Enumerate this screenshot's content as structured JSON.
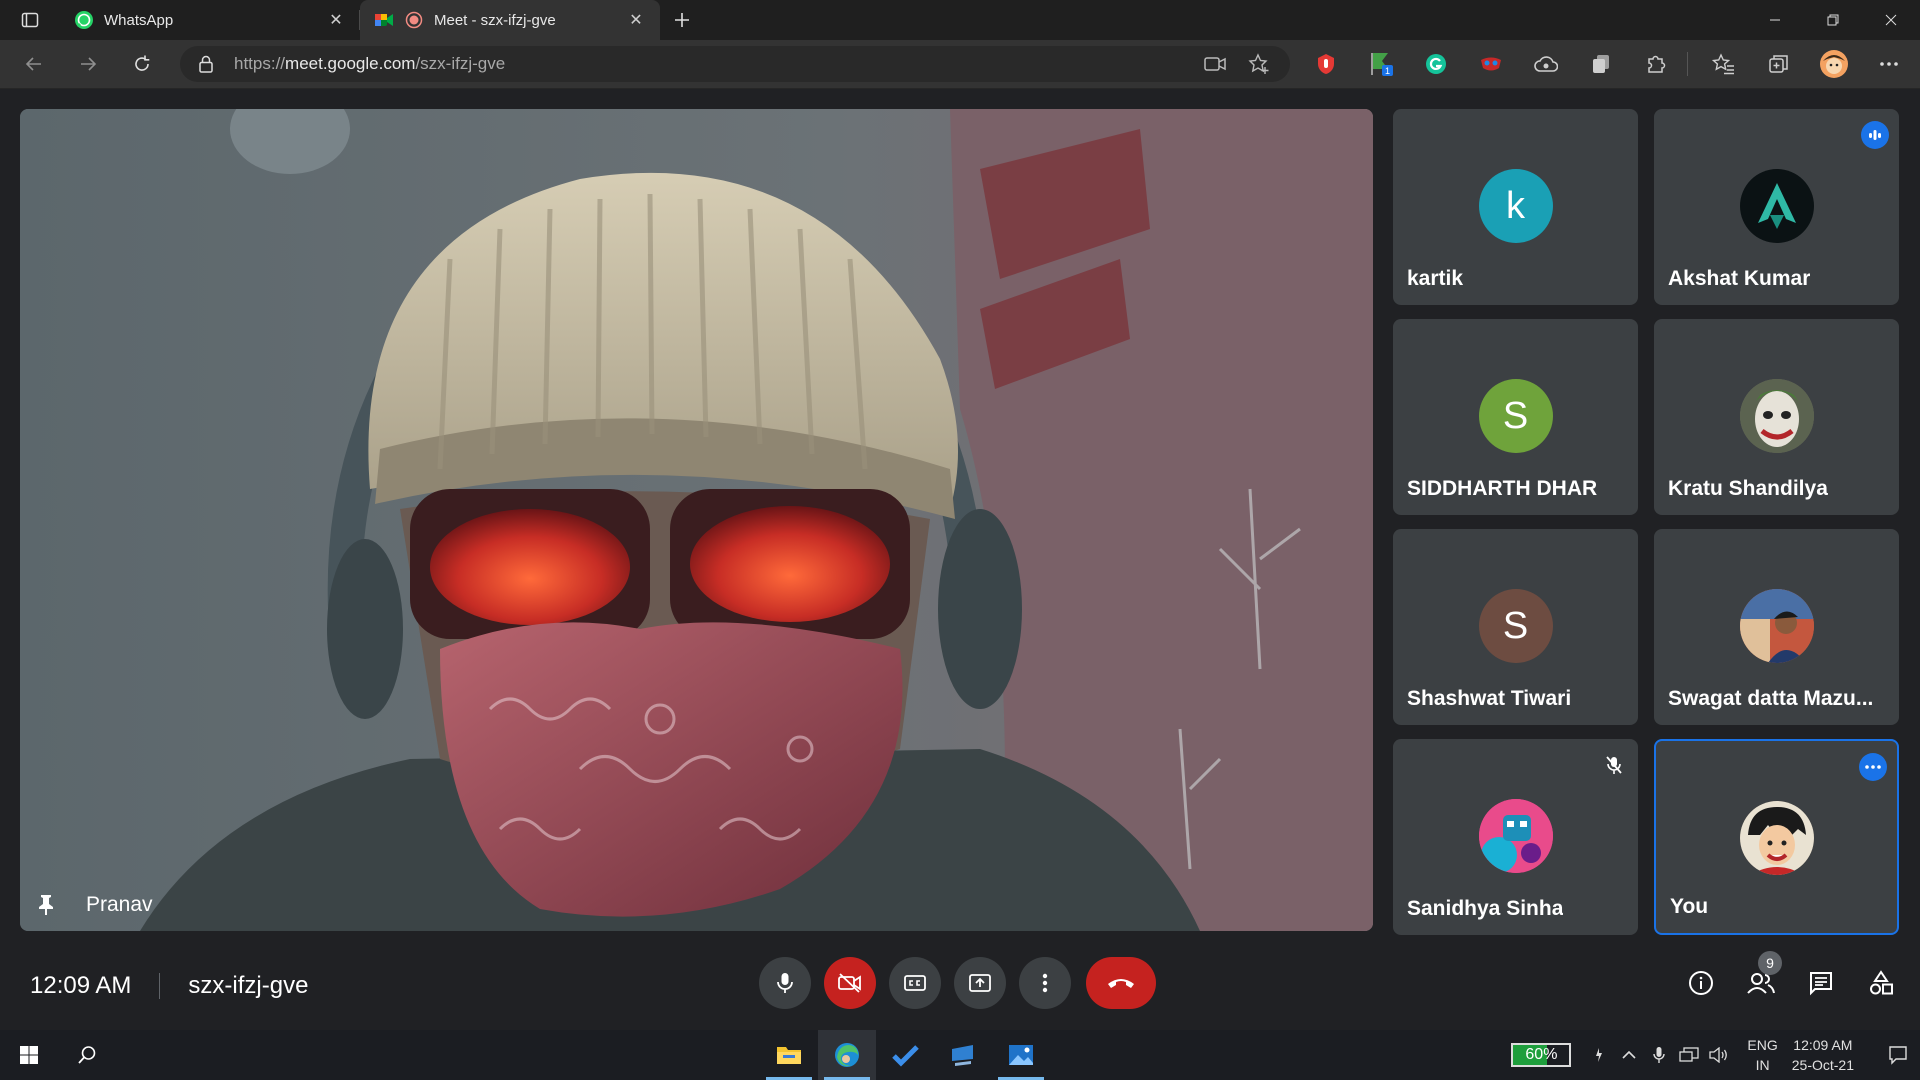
{
  "browser": {
    "tabs": [
      {
        "label": "WhatsApp",
        "icon": "whatsapp-icon",
        "active": false
      },
      {
        "label": "Meet - szx-ifzj-gve",
        "icon": "google-meet-icon",
        "active": true
      }
    ],
    "address": {
      "prefix": "https://",
      "host": "meet.google.com",
      "path": "/szx-ifzj-gve"
    },
    "extensions": [
      "red-record-icon",
      "green-flag-icon",
      "grammarly-icon",
      "mask-icon",
      "cloud-icon",
      "copy-icon",
      "puzzle-icon"
    ],
    "extension_badge": "1"
  },
  "meet": {
    "spotlight": {
      "name": "Pranav"
    },
    "participants": [
      {
        "name": "kartik",
        "initial": "k",
        "color": "#1aa0b5"
      },
      {
        "name": "Akshat Kumar",
        "initial": "",
        "color": "#0b1214",
        "speaking": true
      },
      {
        "name": "SIDDHARTH DHAR",
        "initial": "S",
        "color": "#6fa33b"
      },
      {
        "name": "Kratu Shandilya",
        "initial": "",
        "color": "#6b6b5f"
      },
      {
        "name": "Shashwat Tiwari",
        "initial": "S",
        "color": "#6d4c41"
      },
      {
        "name": "Swagat datta Mazu...",
        "initial": "",
        "color": "#8a6f5a"
      },
      {
        "name": "Sanidhya Sinha",
        "initial": "",
        "color": "#d63a86",
        "muted": true
      },
      {
        "name": "You",
        "initial": "",
        "color": "#2a1a12",
        "self": true
      }
    ],
    "time": "12:09 AM",
    "meeting_code": "szx-ifzj-gve",
    "people_count": "9"
  },
  "taskbar": {
    "battery_label": "60%",
    "battery_level": 0.6,
    "language_line1": "ENG",
    "language_line2": "IN",
    "clock_time": "12:09 AM",
    "clock_date": "25-Oct-21"
  },
  "colors": {
    "meet_bg": "#202124",
    "tile_bg": "#3c4043",
    "end_call": "#c5221f",
    "self_border": "#1a73e8",
    "speaking_indicator": "#1a73e8"
  }
}
